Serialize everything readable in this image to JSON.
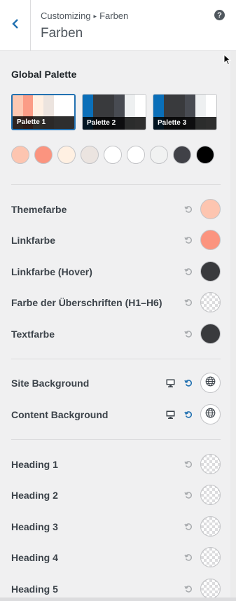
{
  "header": {
    "breadcrumb_parent": "Customizing",
    "breadcrumb_child": "Farben",
    "title": "Farben",
    "help_label": "?"
  },
  "global_palette": {
    "title": "Global Palette",
    "palettes": [
      {
        "label": "Palette 1",
        "colors": [
          "#fdc8b2",
          "#fb9c86",
          "#fff0e3",
          "#ece4df",
          "#ffffff",
          "#ffffff"
        ]
      },
      {
        "label": "Palette 2",
        "colors": [
          "#0a6fb9",
          "#393a3d",
          "#393a3d",
          "#484b52",
          "#eef0f1",
          "#ffffff"
        ]
      },
      {
        "label": "Palette 3",
        "colors": [
          "#0a6fb9",
          "#393a3d",
          "#393a3d",
          "#484b52",
          "#eef0f1",
          "#ffffff"
        ]
      }
    ],
    "swatches": [
      "#fdc5b0",
      "#fb947f",
      "#fff0e2",
      "#ebe4e0",
      "#ffffff",
      "#ffffff",
      "#f1f2f2",
      "#404147",
      "#000000"
    ]
  },
  "colors": [
    {
      "label": "Themefarbe",
      "value": "#fdc5b0"
    },
    {
      "label": "Linkfarbe",
      "value": "#fb947f"
    },
    {
      "label": "Linkfarbe (Hover)",
      "value": "#393a3d"
    },
    {
      "label": "Farbe der Überschriften (H1–H6)",
      "value": ""
    },
    {
      "label": "Textfarbe",
      "value": "#393a3d"
    }
  ],
  "backgrounds": [
    {
      "label": "Site Background"
    },
    {
      "label": "Content Background"
    }
  ],
  "headings": [
    {
      "label": "Heading 1"
    },
    {
      "label": "Heading 2"
    },
    {
      "label": "Heading 3"
    },
    {
      "label": "Heading 4"
    },
    {
      "label": "Heading 5"
    }
  ],
  "theme": {
    "accent": "#2271b1",
    "reset_inactive": "#a7aaad",
    "reset_active": "#2271b1"
  }
}
